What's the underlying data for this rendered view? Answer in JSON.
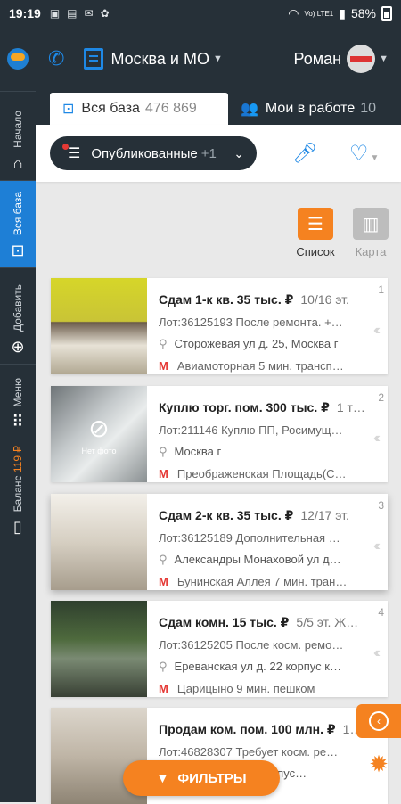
{
  "status": {
    "time": "19:19",
    "battery": "58%",
    "network": "Vo) LTE1",
    "icons": [
      "image-icon",
      "gallery-icon",
      "mail-icon",
      "bug-icon"
    ]
  },
  "sidebar": {
    "items": [
      {
        "label": "Начало",
        "icon": "home-icon"
      },
      {
        "label": "Вся база",
        "icon": "search-db-icon"
      },
      {
        "label": "Добавить",
        "icon": "add-icon"
      },
      {
        "label": "Меню",
        "icon": "grid-icon"
      },
      {
        "label": "Баланс",
        "amount": "119 ₽",
        "icon": "wallet-icon"
      }
    ]
  },
  "header": {
    "region": "Москва и МО",
    "user": "Роман"
  },
  "tabs": [
    {
      "label": "Вся база",
      "count": "476 869"
    },
    {
      "label": "Мои в работе",
      "count": "10"
    }
  ],
  "filter": {
    "label": "Опубликованные",
    "extra": "+1"
  },
  "view_toggle": {
    "list_label": "Список",
    "map_label": "Карта"
  },
  "listings": [
    {
      "num": "1",
      "title": "Сдам 1-к кв. 35 тыс. ₽",
      "floor": "10/16 эт.",
      "lot": "Лот:36125193 После ремонта. +…",
      "address": "Сторожевая ул д. 25, Москва г",
      "metro": "Авиамоторная 5 мин. трансп…"
    },
    {
      "num": "2",
      "title": "Куплю торг. пом. 300 тыс. ₽",
      "floor": "1 т…",
      "lot": "Лот:211146 Куплю ПП, Росимущ…",
      "address": "Москва г",
      "metro": "Преображенская Площадь(С…",
      "no_photo": "Нет фото"
    },
    {
      "num": "3",
      "title": "Сдам 2-к кв. 35 тыс. ₽",
      "floor": "12/17 эт.",
      "lot": "Лот:36125189 Дополнительная …",
      "address": "Александры Монаховой ул д…",
      "metro": "Бунинская Аллея 7 мин. тран…"
    },
    {
      "num": "4",
      "title": "Сдам комн. 15 тыс. ₽",
      "floor": "5/5 эт.   Ж…",
      "lot": "Лот:36125205 После косм. ремо…",
      "address": "Ереванская ул д. 22 корпус к…",
      "metro": "Царицыно 9 мин. пешком"
    },
    {
      "num": "5",
      "title": "Продам ком. пом. 100 млн. ₽",
      "floor": "1…",
      "lot": "Лот:46828307 Требует косм. ре…",
      "address": "д. 16 корпус…",
      "metro": ""
    }
  ],
  "filters_button": "ФИЛЬТРЫ",
  "colors": {
    "accent": "#f58220",
    "primary": "#1e88e5",
    "dark": "#263038"
  }
}
